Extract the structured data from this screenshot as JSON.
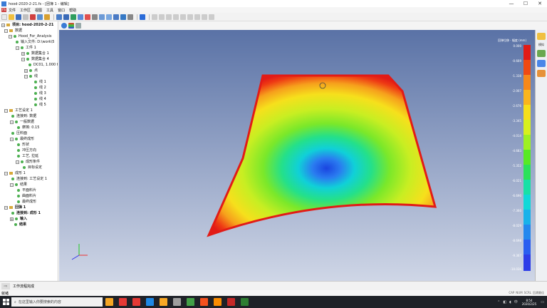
{
  "window": {
    "title": "hood-2020-2-21.fs - [团簿 1 - 编辑]",
    "min": "—",
    "max": "☐",
    "close": "✕"
  },
  "menu": {
    "app_badge": "FS",
    "items": [
      "文件",
      "工作区",
      "视图",
      "工具",
      "窗口",
      "帮助"
    ]
  },
  "tree": {
    "root": "项目: hood-2020-2-21",
    "data": "数据",
    "hood": "Hood_For_Analysis",
    "input_file": "输入文件: D:\\work\\5",
    "tool1": "工件 1",
    "dataset1": "数据集合 1",
    "dataset4": "数据集合 4",
    "dc01": "DC01, 1.000 t",
    "points": "点",
    "lines": "线",
    "line_items": [
      "线 1",
      "线 2",
      "线 3",
      "线 4",
      "线 5"
    ],
    "process": "工艺设定 1",
    "ref_data": "连接到: 数据",
    "general": "一般数据",
    "friction": "摩擦: 0.15",
    "blankholder": "压料面",
    "final_form": "最终成形",
    "shape": "形状",
    "stamping_dir": "冲压方向",
    "process_tie": "工艺, 拉延",
    "form_cond": "成形条件",
    "target": "目标设定",
    "forming": "成形 1",
    "ref_process": "连接到: 工艺设定 1",
    "results": "结果",
    "flat_blank": "平面料片",
    "surface_blank": "曲面料片",
    "final_form2": "最终成形",
    "springback": "回弹 1",
    "ref_forming": "连接到: 成形 1",
    "input": "输入",
    "results2": "结果"
  },
  "legend": {
    "title": "回弹位移 · 幅度 (mm)",
    "ticks": [
      "0.000",
      "-0.669",
      "-1.338",
      "-2.007",
      "-2.676",
      "-3.345",
      "-4.014",
      "-4.683",
      "-5.352",
      "-6.021",
      "-6.690",
      "-7.360",
      "-8.029",
      "-8.698",
      "-9.367",
      "-10.036"
    ],
    "colors": [
      "#e21b16",
      "#f04a12",
      "#f6881b",
      "#f9b51d",
      "#f6df1a",
      "#d7f01d",
      "#9ef022",
      "#57e925",
      "#2be25a",
      "#18e0a6",
      "#10d8d8",
      "#18b2ea",
      "#2388ee",
      "#2a5ef0",
      "#2d3de8"
    ]
  },
  "dock": {
    "label": "模拟"
  },
  "status": {
    "play": "⇨",
    "workflow": "工作流程完成",
    "ready": "就绪",
    "indicators": [
      "CAP",
      "NUM",
      "SCRL",
      "回溯最佳"
    ]
  },
  "taskbar": {
    "search_placeholder": "在这里输入你要搜索的内容",
    "time": "8:54",
    "date": "2020/2/25",
    "ime": "中",
    "icon_colors": [
      "#f5a623",
      "#e53935",
      "#e53935",
      "#1e88e5",
      "#43a047",
      "#f4511e",
      "#fb8c00",
      "#9e9e9e",
      "#c62828",
      "#2e7d32"
    ]
  }
}
